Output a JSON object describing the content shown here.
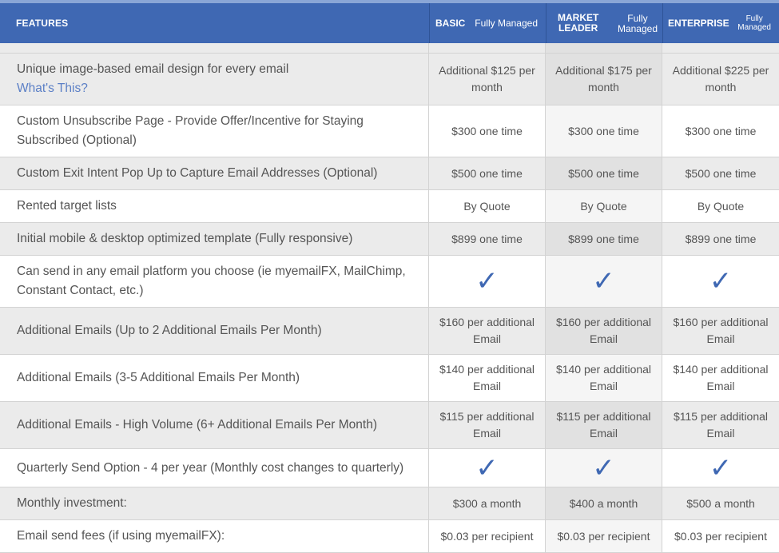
{
  "header": {
    "features_label": "FEATURES",
    "plans": [
      {
        "name": "BASIC",
        "subtitle": "Fully Managed"
      },
      {
        "name_line1": "MARKET",
        "name_line2": "LEADER",
        "subtitle_line1": "Fully",
        "subtitle_line2": "Managed"
      },
      {
        "name": "ENTERPRISE",
        "subtitle_line1": "Fully",
        "subtitle_line2": "Managed"
      }
    ]
  },
  "rows": [
    {
      "feature": "Unique image-based email design for every email",
      "link": "What's This?",
      "values": [
        "Additional $125 per month",
        "Additional $175 per month",
        "Additional $225 per month"
      ]
    },
    {
      "feature": "Custom Unsubscribe Page - Provide Offer/Incentive for Staying Subscribed (Optional)",
      "values": [
        "$300 one time",
        "$300 one time",
        "$300 one time"
      ]
    },
    {
      "feature": "Custom Exit Intent Pop Up to Capture Email Addresses (Optional)",
      "values": [
        "$500 one time",
        "$500 one time",
        "$500 one time"
      ]
    },
    {
      "feature": "Rented target lists",
      "values": [
        "By Quote",
        "By Quote",
        "By Quote"
      ]
    },
    {
      "feature": "Initial mobile & desktop optimized template (Fully responsive)",
      "values": [
        "$899 one time",
        "$899 one time",
        "$899 one time"
      ]
    },
    {
      "feature": "Can send in any email platform you choose (ie myemailFX, MailChimp, Constant Contact, etc.)",
      "values": [
        "✓",
        "✓",
        "✓"
      ]
    },
    {
      "feature": "Additional Emails (Up to 2 Additional Emails Per Month)",
      "values": [
        "$160 per additional Email",
        "$160 per additional Email",
        "$160 per additional Email"
      ]
    },
    {
      "feature": "Additional Emails (3-5 Additional Emails Per Month)",
      "values": [
        "$140 per additional Email",
        "$140 per additional Email",
        "$140 per additional Email"
      ]
    },
    {
      "feature": "Additional Emails - High Volume (6+ Additional Emails Per Month)",
      "values": [
        "$115 per additional Email",
        "$115 per additional Email",
        "$115 per additional Email"
      ]
    },
    {
      "feature": "Quarterly Send Option - 4 per year (Monthly cost changes to quarterly)",
      "values": [
        "✓",
        "✓",
        "✓"
      ]
    },
    {
      "feature": "Monthly investment:",
      "values": [
        "$300 a month",
        "$400 a month",
        "$500 a month"
      ]
    },
    {
      "feature": "Email send fees (if using myemailFX):",
      "values": [
        "$0.03 per recipient",
        "$0.03 per recipient",
        "$0.03 per recipient"
      ]
    }
  ],
  "colors": {
    "header_bg": "#3f68b3",
    "check": "#3f68b3",
    "link": "#5b7fc6",
    "shade": "#ebebeb"
  }
}
